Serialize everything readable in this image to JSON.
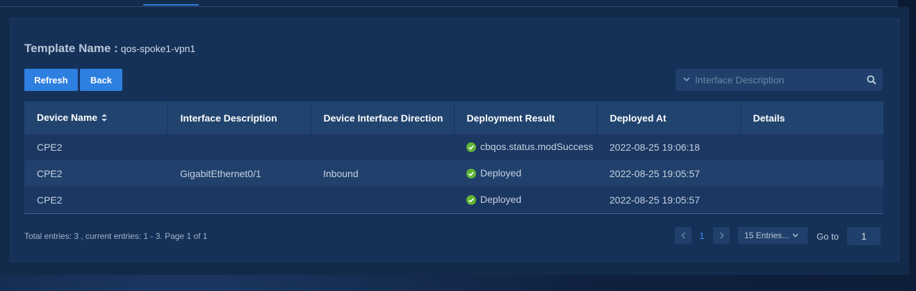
{
  "template": {
    "label": "Template Name :",
    "value": "qos-spoke1-vpn1"
  },
  "toolbar": {
    "refresh_label": "Refresh",
    "back_label": "Back"
  },
  "search": {
    "placeholder": "Interface Description",
    "icon": "search-icon"
  },
  "table": {
    "columns": [
      "Device Name",
      "Interface Description",
      "Device Interface Direction",
      "Deployment Result",
      "Deployed At",
      "Details"
    ],
    "rows": [
      {
        "device": "CPE2",
        "interface": "",
        "direction": "",
        "result": "cbqos.status.modSuccess",
        "deployed_at": "2022-08-25 19:06:18",
        "details": ""
      },
      {
        "device": "CPE2",
        "interface": "GigabitEthernet0/1",
        "direction": "Inbound",
        "result": "Deployed",
        "deployed_at": "2022-08-25 19:05:57",
        "details": ""
      },
      {
        "device": "CPE2",
        "interface": "",
        "direction": "",
        "result": "Deployed",
        "deployed_at": "2022-08-25 19:05:57",
        "details": ""
      }
    ]
  },
  "footer": {
    "summary": "Total entries: 3 , current entries: 1 - 3. Page 1 of 1",
    "current_page": "1",
    "page_size": "15 Entries...",
    "goto_label": "Go to",
    "goto_value": "1"
  },
  "colors": {
    "accent": "#2d7fe0",
    "success": "#5fb336",
    "background": "#163158"
  }
}
